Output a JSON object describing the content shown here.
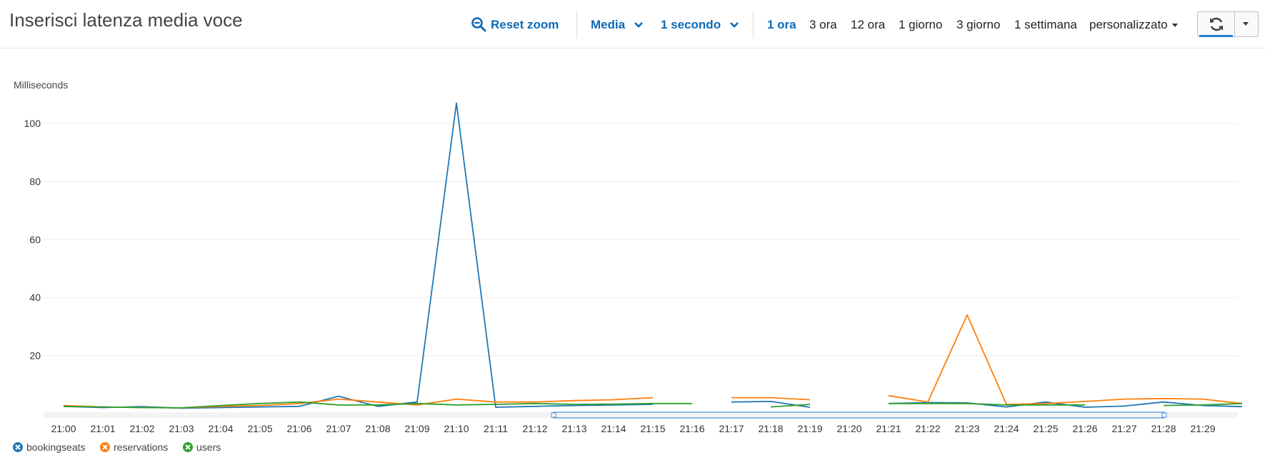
{
  "header": {
    "title": "Inserisci latenza media voce",
    "reset_zoom": "Reset zoom",
    "statistic": "Media",
    "period": "1 secondo",
    "ranges": [
      "1 ora",
      "3 ora",
      "12 ora",
      "1 giorno",
      "3 giorno",
      "1 settimana"
    ],
    "active_range": "1 ora",
    "custom": "personalizzato"
  },
  "colors": {
    "accent": "#0f6ab4",
    "bookingseats": "#1f77b4",
    "reservations": "#ff7f0e",
    "users": "#2ca02c"
  },
  "icons": {
    "reset_zoom": "magnifier-minus-icon",
    "refresh": "refresh-icon",
    "dropdown": "caret-down-icon"
  },
  "legend": [
    "bookingseats",
    "reservations",
    "users"
  ],
  "chart_data": {
    "type": "line",
    "ylabel": "Milliseconds",
    "ylim": [
      0,
      110
    ],
    "yticks": [
      20,
      40,
      60,
      80,
      100
    ],
    "grid": true,
    "legend_position": "bottom-left",
    "x_tick_labels": [
      "21:00",
      "21:01",
      "21:02",
      "21:03",
      "21:04",
      "21:05",
      "21:06",
      "21:07",
      "21:08",
      "21:09",
      "21:10",
      "21:11",
      "21:12",
      "21:13",
      "21:14",
      "21:15",
      "21:16",
      "21:17",
      "21:18",
      "21:19",
      "21:20",
      "21:21",
      "21:22",
      "21:23",
      "21:24",
      "21:25",
      "21:26",
      "21:27",
      "21:28",
      "21:29"
    ],
    "series": [
      {
        "name": "bookingseats",
        "segments": [
          [
            [
              "21:00",
              2.5
            ],
            [
              "21:01",
              2.1
            ],
            [
              "21:02",
              2.4
            ],
            [
              "21:03",
              1.9
            ],
            [
              "21:04",
              2.1
            ],
            [
              "21:05",
              2.3
            ],
            [
              "21:06",
              2.5
            ],
            [
              "21:07",
              6.0
            ],
            [
              "21:08",
              2.5
            ],
            [
              "21:09",
              4.0
            ],
            [
              "21:10",
              107.0
            ],
            [
              "21:11",
              2.2
            ],
            [
              "21:12",
              2.5
            ],
            [
              "21:13",
              2.8
            ],
            [
              "21:14",
              3.0
            ],
            [
              "21:15",
              3.2
            ]
          ],
          [
            [
              "21:17",
              4.0
            ],
            [
              "21:18",
              4.2
            ],
            [
              "21:19",
              2.2
            ]
          ],
          [
            [
              "21:21",
              3.5
            ],
            [
              "21:22",
              3.8
            ],
            [
              "21:23",
              3.7
            ],
            [
              "21:24",
              2.3
            ],
            [
              "21:25",
              4.0
            ],
            [
              "21:26",
              2.2
            ],
            [
              "21:27",
              2.6
            ],
            [
              "21:28",
              4.0
            ],
            [
              "21:29",
              2.8
            ],
            [
              "21:30",
              2.4
            ]
          ]
        ]
      },
      {
        "name": "reservations",
        "segments": [
          [
            [
              "21:00",
              2.8
            ],
            [
              "21:01",
              2.3
            ],
            [
              "21:02",
              2.1
            ],
            [
              "21:03",
              2.0
            ],
            [
              "21:04",
              2.5
            ],
            [
              "21:05",
              2.8
            ],
            [
              "21:06",
              3.5
            ],
            [
              "21:07",
              5.0
            ],
            [
              "21:08",
              4.0
            ],
            [
              "21:09",
              3.0
            ],
            [
              "21:10",
              5.0
            ],
            [
              "21:11",
              4.0
            ],
            [
              "21:12",
              4.0
            ],
            [
              "21:13",
              4.5
            ],
            [
              "21:14",
              4.8
            ],
            [
              "21:15",
              5.5
            ]
          ],
          [
            [
              "21:17",
              5.5
            ],
            [
              "21:18",
              5.5
            ],
            [
              "21:19",
              4.8
            ]
          ],
          [
            [
              "21:21",
              6.2
            ],
            [
              "21:22",
              4.0
            ],
            [
              "21:23",
              34.0
            ],
            [
              "21:24",
              3.2
            ],
            [
              "21:25",
              3.5
            ],
            [
              "21:26",
              4.2
            ],
            [
              "21:27",
              5.0
            ],
            [
              "21:28",
              5.2
            ],
            [
              "21:29",
              5.0
            ],
            [
              "21:30",
              3.5
            ]
          ]
        ]
      },
      {
        "name": "users",
        "segments": [
          [
            [
              "21:00",
              2.5
            ],
            [
              "21:01",
              2.3
            ],
            [
              "21:02",
              2.1
            ],
            [
              "21:03",
              2.0
            ],
            [
              "21:04",
              2.8
            ],
            [
              "21:05",
              3.5
            ],
            [
              "21:06",
              4.0
            ],
            [
              "21:07",
              3.0
            ],
            [
              "21:08",
              3.0
            ],
            [
              "21:09",
              3.5
            ],
            [
              "21:10",
              3.0
            ],
            [
              "21:11",
              3.2
            ],
            [
              "21:12",
              3.5
            ],
            [
              "21:13",
              3.2
            ],
            [
              "21:14",
              3.3
            ],
            [
              "21:15",
              3.5
            ],
            [
              "21:16",
              3.5
            ]
          ],
          [
            [
              "21:18",
              2.3
            ],
            [
              "21:19",
              3.2
            ]
          ],
          [
            [
              "21:21",
              3.5
            ],
            [
              "21:22",
              3.5
            ],
            [
              "21:23",
              3.5
            ],
            [
              "21:24",
              3.0
            ],
            [
              "21:25",
              3.0
            ],
            [
              "21:26",
              3.0
            ]
          ],
          [
            [
              "21:28",
              2.8
            ],
            [
              "21:29",
              3.0
            ],
            [
              "21:30",
              3.5
            ]
          ]
        ]
      }
    ]
  }
}
